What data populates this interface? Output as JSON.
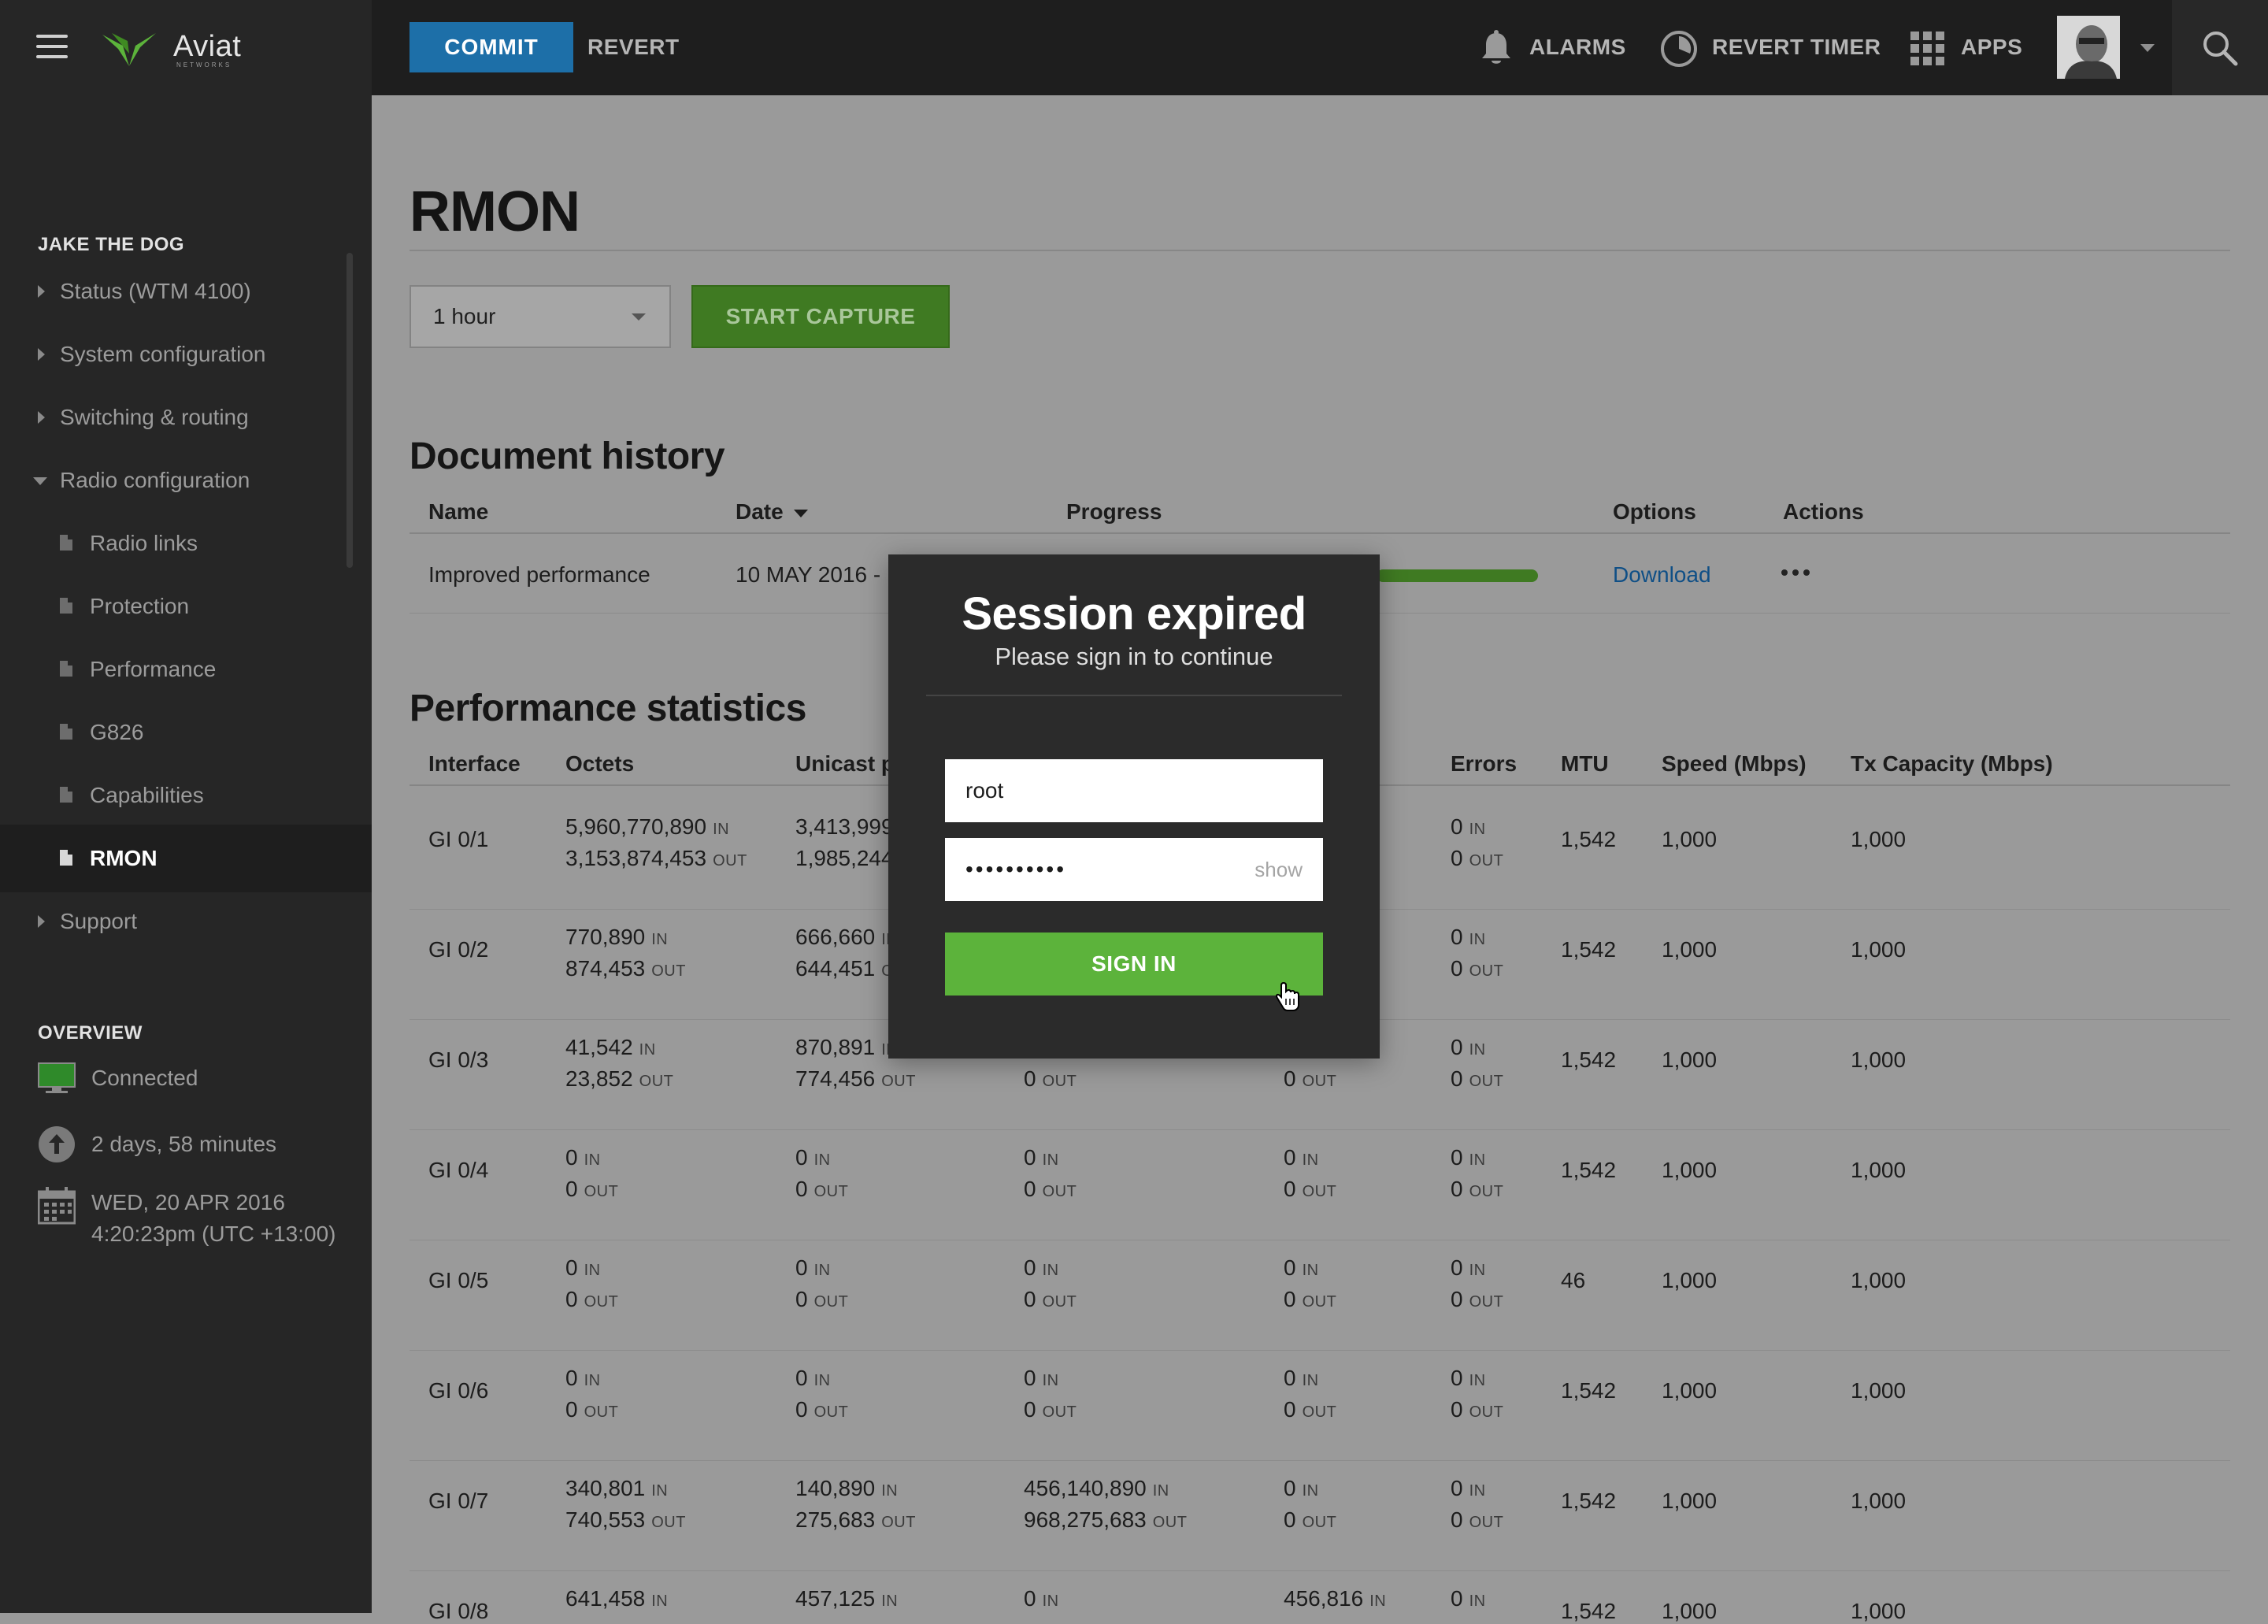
{
  "topbar": {
    "logo_text": "Aviat",
    "logo_sub": "NETWORKS",
    "commit_label": "COMMIT",
    "revert_label": "REVERT",
    "alarms_label": "ALARMS",
    "revert_timer_label": "REVERT TIMER",
    "apps_label": "APPS"
  },
  "sidebar": {
    "device_heading": "JAKE THE DOG",
    "items": [
      {
        "label": "Status (WTM 4100)"
      },
      {
        "label": "System configuration"
      },
      {
        "label": "Switching & routing"
      },
      {
        "label": "Radio configuration"
      }
    ],
    "sub_items": [
      {
        "label": "Radio links"
      },
      {
        "label": "Protection"
      },
      {
        "label": "Performance"
      },
      {
        "label": "G826"
      },
      {
        "label": "Capabilities"
      },
      {
        "label": "RMON"
      }
    ],
    "support_label": "Support",
    "overview_heading": "OVERVIEW",
    "overview": {
      "connection": "Connected",
      "uptime": "2 days, 58 minutes",
      "date_line1": "WED, 20 APR 2016",
      "date_line2": "4:20:23pm (UTC +13:00)"
    }
  },
  "main": {
    "title": "RMON",
    "duration_select": "1 hour",
    "start_capture_label": "START CAPTURE",
    "document_history": {
      "title": "Document history",
      "headers": {
        "name": "Name",
        "date": "Date",
        "progress": "Progress",
        "options": "Options",
        "actions": "Actions"
      },
      "row": {
        "name": "Improved performance",
        "date": "10 MAY 2016 -",
        "progress": 1.0,
        "option": "Download"
      }
    },
    "performance_statistics": {
      "title": "Performance statistics",
      "headers": {
        "interface": "Interface",
        "octets": "Octets",
        "unicast": "Unicast p",
        "errors": "Errors",
        "mtu": "MTU",
        "speed": "Speed (Mbps)",
        "tx": "Tx Capacity (Mbps)"
      },
      "unit_in": "IN",
      "unit_out": "OUT",
      "rows": [
        {
          "iface": "GI 0/1",
          "oct_in": "5,960,770,890",
          "oct_out": "3,153,874,453",
          "uni_in": "3,413,999",
          "uni_out": "1,985,244",
          "c3_in": "",
          "c3_out": "",
          "c4_in": "",
          "c4_out": "",
          "err_in": "0",
          "err_out": "0",
          "mtu": "1,542",
          "speed": "1,000",
          "tx": "1,000"
        },
        {
          "iface": "GI 0/2",
          "oct_in": "770,890",
          "oct_out": "874,453",
          "uni_in": "666,660",
          "uni_out": "644,451",
          "c3_in": "",
          "c3_out": "",
          "c4_in": "",
          "c4_out": "",
          "err_in": "0",
          "err_out": "0",
          "mtu": "1,542",
          "speed": "1,000",
          "tx": "1,000"
        },
        {
          "iface": "GI 0/3",
          "oct_in": "41,542",
          "oct_out": "23,852",
          "uni_in": "870,891",
          "uni_out": "774,456",
          "c3_in": "",
          "c3_out": "0",
          "c4_in": "",
          "c4_out": "0",
          "err_in": "0",
          "err_out": "0",
          "mtu": "1,542",
          "speed": "1,000",
          "tx": "1,000"
        },
        {
          "iface": "GI 0/4",
          "oct_in": "0",
          "oct_out": "0",
          "uni_in": "0",
          "uni_out": "0",
          "c3_in": "0",
          "c3_out": "0",
          "c4_in": "0",
          "c4_out": "0",
          "err_in": "0",
          "err_out": "0",
          "mtu": "1,542",
          "speed": "1,000",
          "tx": "1,000"
        },
        {
          "iface": "GI 0/5",
          "oct_in": "0",
          "oct_out": "0",
          "uni_in": "0",
          "uni_out": "0",
          "c3_in": "0",
          "c3_out": "0",
          "c4_in": "0",
          "c4_out": "0",
          "err_in": "0",
          "err_out": "0",
          "mtu": "46",
          "speed": "1,000",
          "tx": "1,000"
        },
        {
          "iface": "GI 0/6",
          "oct_in": "0",
          "oct_out": "0",
          "uni_in": "0",
          "uni_out": "0",
          "c3_in": "0",
          "c3_out": "0",
          "c4_in": "0",
          "c4_out": "0",
          "err_in": "0",
          "err_out": "0",
          "mtu": "1,542",
          "speed": "1,000",
          "tx": "1,000"
        },
        {
          "iface": "GI 0/7",
          "oct_in": "340,801",
          "oct_out": "740,553",
          "uni_in": "140,890",
          "uni_out": "275,683",
          "c3_in": "456,140,890",
          "c3_out": "968,275,683",
          "c4_in": "0",
          "c4_out": "0",
          "err_in": "0",
          "err_out": "0",
          "mtu": "1,542",
          "speed": "1,000",
          "tx": "1,000"
        },
        {
          "iface": "GI 0/8",
          "oct_in": "641,458",
          "oct_out": "",
          "uni_in": "457,125",
          "uni_out": "",
          "c3_in": "0",
          "c3_out": "",
          "c4_in": "456,816",
          "c4_out": "",
          "err_in": "0",
          "err_out": "",
          "mtu": "1,542",
          "speed": "1,000",
          "tx": "1,000"
        }
      ]
    }
  },
  "modal": {
    "title": "Session expired",
    "subtitle": "Please sign in to continue",
    "username_value": "root",
    "password_value": "••••••••••",
    "show_label": "show",
    "signin_label": "SIGN IN"
  },
  "colors": {
    "commit_blue": "#1d6fa8",
    "signin_green": "#5cb33b",
    "start_capture_green": "#3f7a22",
    "link_blue": "#0f4f86"
  },
  "icons": [
    "hamburger-icon",
    "aviat-logo-icon",
    "bell-icon",
    "timer-icon",
    "apps-grid-icon",
    "search-icon",
    "monitor-icon",
    "up-arrow-icon",
    "calendar-icon",
    "document-icon",
    "hand-cursor-icon"
  ]
}
